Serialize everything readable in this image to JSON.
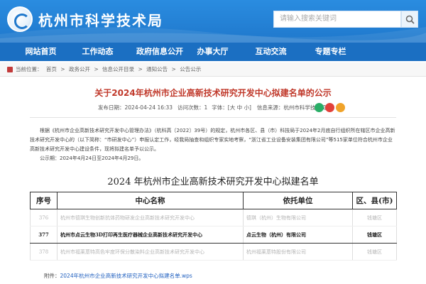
{
  "header": {
    "site_title": "杭州市科学技术局",
    "search_placeholder": "请输入搜索关键词"
  },
  "nav": {
    "items": [
      "网站首页",
      "工作动态",
      "政府信息公开",
      "办事大厅",
      "互动交流",
      "专题专栏"
    ]
  },
  "breadcrumb": {
    "items": [
      "当前位置：",
      "首页",
      ">",
      "政务公开",
      ">",
      "信息公开目录",
      ">",
      "通知公告",
      ">",
      "公告公示"
    ]
  },
  "article": {
    "title": "关于2024年杭州市企业高新技术研究开发中心拟建名单的公示",
    "date_label": "发布日期：2024-04-24 16:33",
    "views_label": "访问次数：1",
    "font_size_label": "字体：[大 中 小]",
    "source_label": "信息来源：杭州市科学技术局",
    "paragraph1": "根据《杭州市企业高新技术研究开发中心管理办法》（杭科高〔2022〕39号）的规定，杭州市各区、县（市）科技局于2024年2月底自行组织所在辖区市企业高新技术研究开发中心的（以下简称：“市研发中心”）申报认定工作，经我局抽查和组织专家实地考察，“浙江省工业设备安装集团有限公司”等515家单位符合杭州市企业高新技术研究开发中心建设条件，现将拟建名单予以公示。",
    "paragraph2": "公示期：2024年4月24日至2024年4月29日。"
  },
  "list": {
    "title": "2024 年杭州市企业高新技术研究开发中心拟建名单",
    "headers": [
      "序号",
      "中心名称",
      "依托单位",
      "区、县(市)"
    ],
    "rows": [
      {
        "no": "376",
        "name": "杭州市德琪生物创新抗体药物研发企业高新技术研究开发中心",
        "unit": "德琪（杭州）生物有限公司",
        "district": "钱塘区",
        "style": "faded"
      },
      {
        "no": "377",
        "name": "杭州市点云生物3D打印再生医疗器械企业高新技术研究开发中心",
        "unit": "点云生物（杭州）有限公司",
        "district": "钱塘区",
        "style": "bold"
      },
      {
        "no": "378",
        "name": "杭州市福莱蒽特高色牢度环保分散染料企业高新技术研究开发中心",
        "unit": "杭州福莱蒽特股份有限公司",
        "district": "钱塘区",
        "style": "faded"
      }
    ]
  },
  "attachment": {
    "label": "附件：",
    "link": "2024年杭州市企业高新技术研究开发中心拟建名单.wps"
  },
  "colors": {
    "header_blue": "#2a8ce0",
    "nav_blue": "#1b6fc2",
    "title_red": "#c0392b",
    "wechat_green": "#2aae67",
    "weibo_red": "#e2413a",
    "qq_orange": "#f0a32a"
  }
}
